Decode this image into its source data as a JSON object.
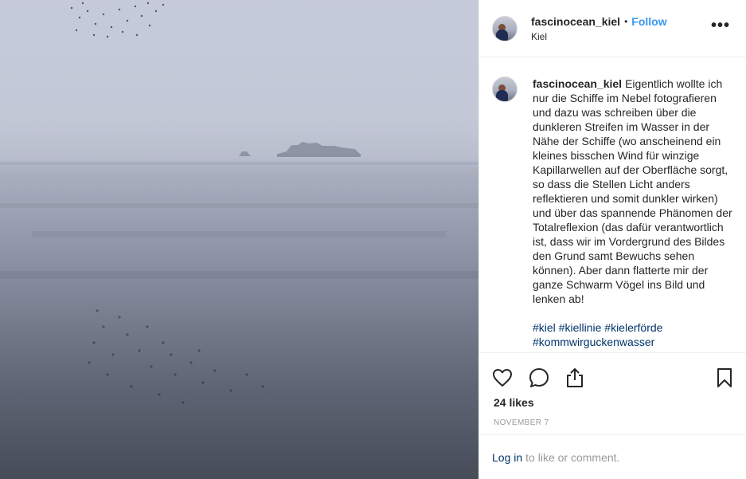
{
  "post": {
    "username": "fascinocean_kiel",
    "separator": "•",
    "follow_label": "Follow",
    "location": "Kiel",
    "more_icon": "more-options-icon",
    "more_text": "•••"
  },
  "caption": {
    "username": "fascinocean_kiel",
    "text": "Eigentlich wollte ich nur die Schiffe im Nebel fotografieren und dazu was schreiben über die dunkleren Streifen im Wasser in der Nähe der Schiffe (wo anscheinend ein kleines bisschen Wind für winzige Kapillarwellen auf der Oberfläche sorgt, so dass die Stellen Licht anders reflektieren und somit dunkler wirken) und über das spannende Phänomen der Totalreflexion (das dafür verantwortlich ist, dass wir im Vordergrund des Bildes den Grund samt Bewuchs sehen können). Aber dann flatterte mir der ganze Schwarm Vögel ins Bild und lenken ab!",
    "hashtags": [
      "#kiel",
      "#kiellinie",
      "#kielerförde",
      "#kommwirguckenwasser"
    ]
  },
  "actions": {
    "icons": [
      "heart-icon",
      "comment-icon",
      "share-icon",
      "bookmark-icon"
    ]
  },
  "likes": "24 likes",
  "date": "NOVEMBER 7",
  "login": {
    "link": "Log in",
    "rest": "to like or comment."
  },
  "colors": {
    "link_blue": "#3897f0",
    "hashtag_blue": "#003569",
    "muted_gray": "#999999",
    "text": "#262626"
  }
}
